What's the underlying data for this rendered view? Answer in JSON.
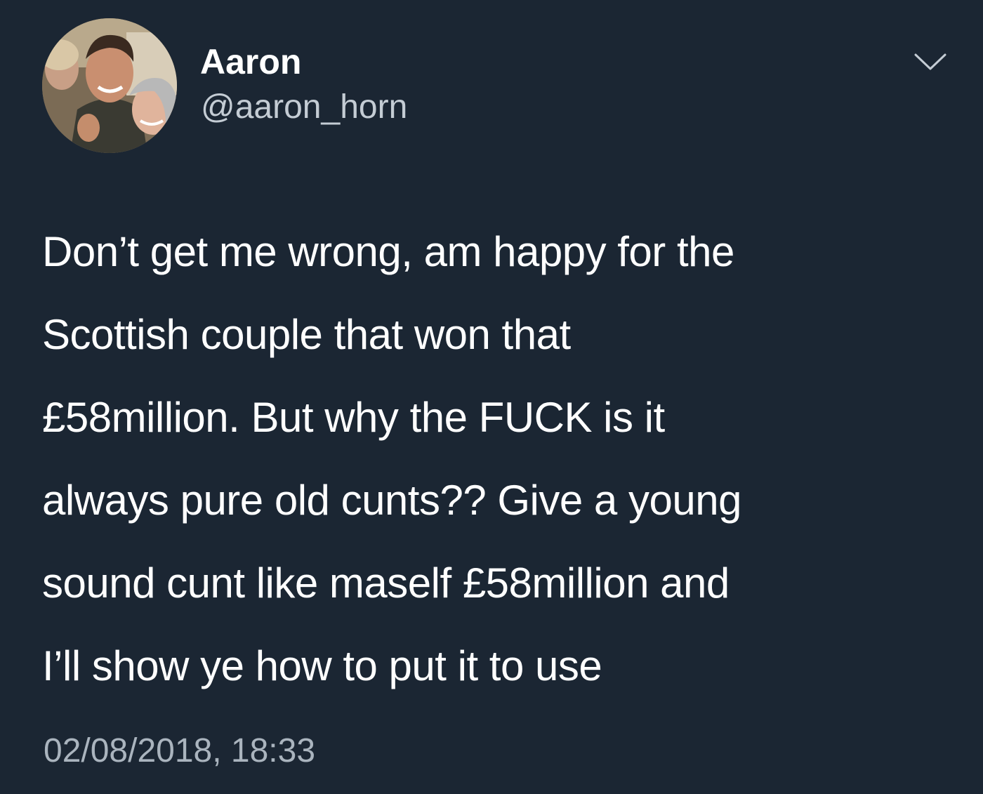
{
  "author": {
    "display_name": "Aaron",
    "handle": "@aaron_horn",
    "avatar_icon": "profile-photo"
  },
  "menu": {
    "icon": "chevron-down-icon"
  },
  "tweet": {
    "text": "Don’t get me wrong, am happy for the\nScottish couple that won that\n£58million. But why the FUCK is it\nalways pure old cunts?? Give a young\nsound cunt like maself £58million and\nI’ll show ye how to put it to use",
    "timestamp": "02/08/2018, 18:33"
  },
  "colors": {
    "background": "#1b2633",
    "primary_text": "#ffffff",
    "secondary_text": "#aab4be"
  }
}
